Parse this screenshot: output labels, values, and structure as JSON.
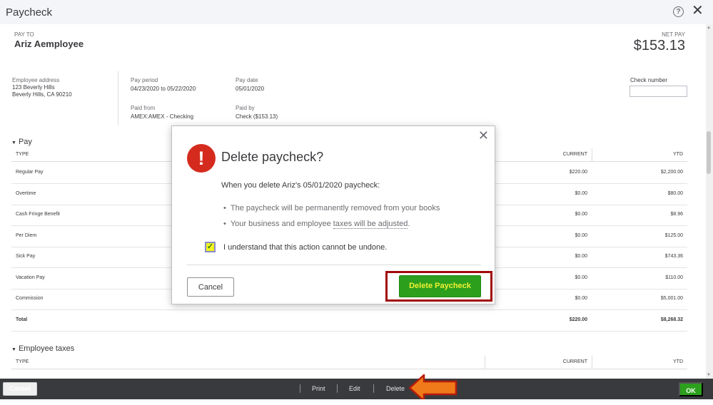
{
  "window": {
    "title": "Paycheck",
    "help_icon": "help-icon",
    "close_icon": "close-icon"
  },
  "header": {
    "pay_to_label": "PAY TO",
    "employee_name": "Ariz Aemployee",
    "net_pay_label": "NET PAY",
    "net_pay_value": "$153.13"
  },
  "details": {
    "address_label": "Employee address",
    "address_line1": "123 Beverly Hills",
    "address_line2": "Beverly Hills, CA 90210",
    "pay_period_label": "Pay period",
    "pay_period_value": "04/23/2020 to 05/22/2020",
    "pay_date_label": "Pay date",
    "pay_date_value": "05/01/2020",
    "paid_from_label": "Paid from",
    "paid_from_value": "AMEX:AMEX - Checking",
    "paid_by_label": "Paid by",
    "paid_by_value": "Check ($153.13)",
    "check_number_label": "Check number",
    "check_number_value": ""
  },
  "pay_section": {
    "title": "Pay",
    "headers": {
      "type": "TYPE",
      "current": "CURRENT",
      "ytd": "YTD"
    },
    "rows": [
      {
        "type": "Regular Pay",
        "current": "$220.00",
        "ytd": "$2,200.00"
      },
      {
        "type": "Overtime",
        "current": "$0.00",
        "ytd": "$80.00"
      },
      {
        "type": "Cash Fringe Benefit",
        "current": "$0.00",
        "ytd": "$8.96"
      },
      {
        "type": "Per Diem",
        "current": "$0.00",
        "ytd": "$125.00"
      },
      {
        "type": "Sick Pay",
        "current": "$0.00",
        "ytd": "$743.36"
      },
      {
        "type": "Vacation Pay",
        "current": "$0.00",
        "ytd": "$110.00"
      },
      {
        "type": "Commission",
        "current": "$0.00",
        "ytd": "$5,001.00"
      }
    ],
    "total": {
      "type": "Total",
      "current": "$220.00",
      "ytd": "$8,268.32"
    }
  },
  "employee_taxes_section": {
    "title": "Employee taxes",
    "headers": {
      "type": "TYPE",
      "current": "CURRENT",
      "ytd": "YTD"
    }
  },
  "modal": {
    "title": "Delete paycheck?",
    "lead": "When you delete Ariz's 05/01/2020 paycheck:",
    "bullet1": "The paycheck will be permanently removed from your books",
    "bullet2_prefix": "Your business and employee ",
    "bullet2_link": "taxes will be adjusted",
    "bullet2_suffix": ".",
    "checkbox_label": "I understand that this action cannot be undone.",
    "checkbox_checked": true,
    "alert_glyph": "!",
    "cancel_label": "Cancel",
    "delete_label": "Delete Paycheck"
  },
  "footer": {
    "cancel_label": "Cancel",
    "print_label": "Print",
    "edit_label": "Edit",
    "delete_label": "Delete",
    "ok_label": "OK"
  },
  "colors": {
    "primary_green": "#2ca01c",
    "alert_red": "#d52b1e",
    "highlight_red": "#a10a0a",
    "arrow_orange": "#f07a1a",
    "footer_bg": "#393a3d"
  }
}
